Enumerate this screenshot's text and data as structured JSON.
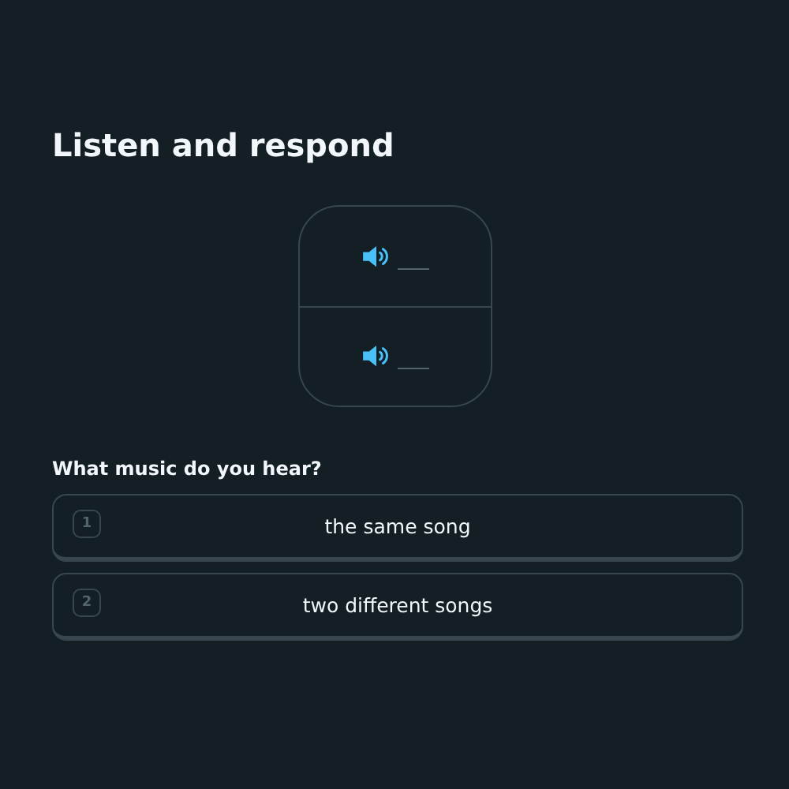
{
  "title": "Listen and respond",
  "audio_clips": [
    {
      "kind": "speaker"
    },
    {
      "kind": "speaker"
    }
  ],
  "question": "What music do you hear?",
  "options": [
    {
      "key": "1",
      "label": "the same song",
      "selected": false
    },
    {
      "key": "2",
      "label": "two different songs",
      "selected": false
    }
  ]
}
